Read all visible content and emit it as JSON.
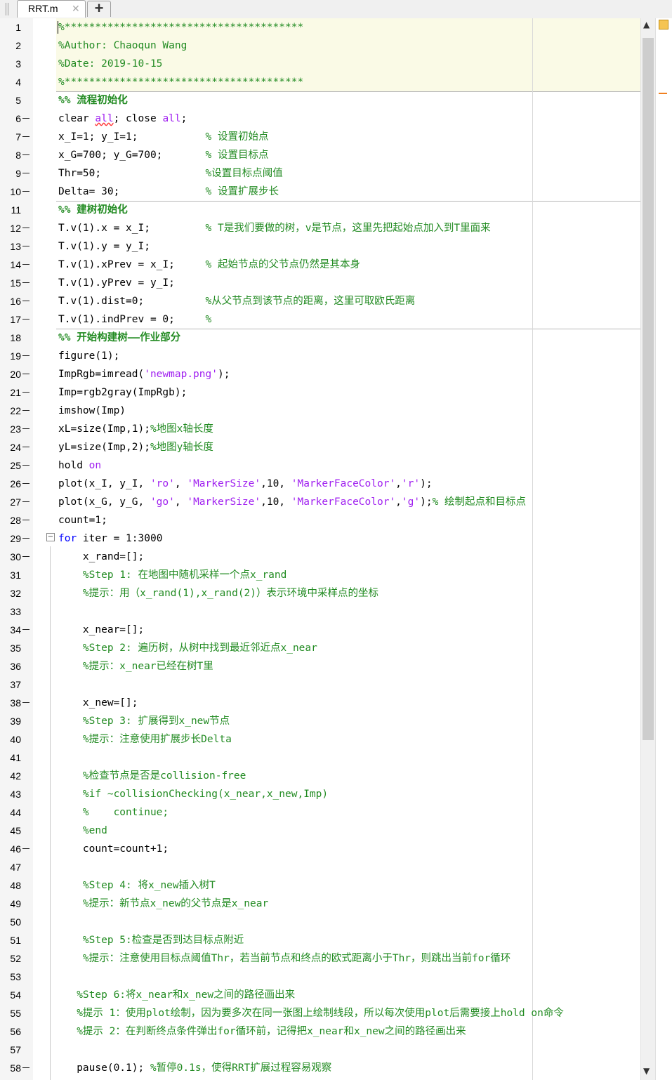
{
  "tabs": {
    "active": "RRT.m",
    "close_glyph": "✕",
    "add_glyph": "+"
  },
  "icons": {
    "fold": "fold-minus-icon",
    "status": "code-analyzer-status-icon",
    "scroll_up": "up-arrow-icon",
    "scroll_down": "down-arrow-icon"
  },
  "colors": {
    "keyword": "#0000ff",
    "string": "#a020f0",
    "comment": "#228b22",
    "cell_bg": "#fafae6",
    "status": "#f5c453"
  },
  "lines": [
    {
      "n": "1",
      "bp": false,
      "segs": [
        [
          "c",
          "%***************************************"
        ]
      ]
    },
    {
      "n": "2",
      "bp": false,
      "segs": [
        [
          "c",
          "%Author: Chaoqun Wang"
        ]
      ]
    },
    {
      "n": "3",
      "bp": false,
      "segs": [
        [
          "c",
          "%Date: 2019-10-15"
        ]
      ]
    },
    {
      "n": "4",
      "bp": false,
      "segs": [
        [
          "c",
          "%***************************************"
        ]
      ]
    },
    {
      "n": "5",
      "bp": false,
      "segs": [
        [
          "h",
          "%% 流程初始化"
        ]
      ]
    },
    {
      "n": "6",
      "bp": true,
      "segs": [
        [
          "t",
          "clear "
        ],
        [
          "su",
          "all"
        ],
        [
          "t",
          "; close "
        ],
        [
          "s",
          "all"
        ],
        [
          "t",
          ";"
        ]
      ]
    },
    {
      "n": "7",
      "bp": true,
      "segs": [
        [
          "t",
          "x_I=1; y_I=1;           "
        ],
        [
          "c",
          "% 设置初始点"
        ]
      ]
    },
    {
      "n": "8",
      "bp": true,
      "segs": [
        [
          "t",
          "x_G=700; y_G=700;       "
        ],
        [
          "c",
          "% 设置目标点"
        ]
      ]
    },
    {
      "n": "9",
      "bp": true,
      "segs": [
        [
          "t",
          "Thr=50;                 "
        ],
        [
          "c",
          "%设置目标点阈值"
        ]
      ]
    },
    {
      "n": "10",
      "bp": true,
      "segs": [
        [
          "t",
          "Delta= 30;              "
        ],
        [
          "c",
          "% 设置扩展步长"
        ]
      ]
    },
    {
      "n": "11",
      "bp": false,
      "segs": [
        [
          "h",
          "%% 建树初始化"
        ]
      ]
    },
    {
      "n": "12",
      "bp": true,
      "segs": [
        [
          "t",
          "T.v(1).x = x_I;         "
        ],
        [
          "c",
          "% T是我们要做的树，v是节点，这里先把起始点加入到T里面来"
        ]
      ]
    },
    {
      "n": "13",
      "bp": true,
      "segs": [
        [
          "t",
          "T.v(1).y = y_I;"
        ]
      ]
    },
    {
      "n": "14",
      "bp": true,
      "segs": [
        [
          "t",
          "T.v(1).xPrev = x_I;     "
        ],
        [
          "c",
          "% 起始节点的父节点仍然是其本身"
        ]
      ]
    },
    {
      "n": "15",
      "bp": true,
      "segs": [
        [
          "t",
          "T.v(1).yPrev = y_I;"
        ]
      ]
    },
    {
      "n": "16",
      "bp": true,
      "segs": [
        [
          "t",
          "T.v(1).dist=0;          "
        ],
        [
          "c",
          "%从父节点到该节点的距离，这里可取欧氏距离"
        ]
      ]
    },
    {
      "n": "17",
      "bp": true,
      "segs": [
        [
          "t",
          "T.v(1).indPrev = 0;     "
        ],
        [
          "c",
          "%"
        ]
      ]
    },
    {
      "n": "18",
      "bp": false,
      "segs": [
        [
          "h",
          "%% 开始构建树——作业部分"
        ]
      ]
    },
    {
      "n": "19",
      "bp": true,
      "segs": [
        [
          "t",
          "figure(1);"
        ]
      ]
    },
    {
      "n": "20",
      "bp": true,
      "segs": [
        [
          "t",
          "ImpRgb=imread("
        ],
        [
          "s",
          "'newmap.png'"
        ],
        [
          "t",
          ");"
        ]
      ]
    },
    {
      "n": "21",
      "bp": true,
      "segs": [
        [
          "t",
          "Imp=rgb2gray(ImpRgb);"
        ]
      ]
    },
    {
      "n": "22",
      "bp": true,
      "segs": [
        [
          "t",
          "imshow(Imp)"
        ]
      ]
    },
    {
      "n": "23",
      "bp": true,
      "segs": [
        [
          "t",
          "xL=size(Imp,1);"
        ],
        [
          "c",
          "%地图x轴长度"
        ]
      ]
    },
    {
      "n": "24",
      "bp": true,
      "segs": [
        [
          "t",
          "yL=size(Imp,2);"
        ],
        [
          "c",
          "%地图y轴长度"
        ]
      ]
    },
    {
      "n": "25",
      "bp": true,
      "segs": [
        [
          "t",
          "hold "
        ],
        [
          "s",
          "on"
        ]
      ]
    },
    {
      "n": "26",
      "bp": true,
      "segs": [
        [
          "t",
          "plot(x_I, y_I, "
        ],
        [
          "s",
          "'ro'"
        ],
        [
          "t",
          ", "
        ],
        [
          "s",
          "'MarkerSize'"
        ],
        [
          "t",
          ",10, "
        ],
        [
          "s",
          "'MarkerFaceColor'"
        ],
        [
          "t",
          ","
        ],
        [
          "s",
          "'r'"
        ],
        [
          "t",
          ");"
        ]
      ]
    },
    {
      "n": "27",
      "bp": true,
      "segs": [
        [
          "t",
          "plot(x_G, y_G, "
        ],
        [
          "s",
          "'go'"
        ],
        [
          "t",
          ", "
        ],
        [
          "s",
          "'MarkerSize'"
        ],
        [
          "t",
          ",10, "
        ],
        [
          "s",
          "'MarkerFaceColor'"
        ],
        [
          "t",
          ","
        ],
        [
          "s",
          "'g'"
        ],
        [
          "t",
          ");"
        ],
        [
          "c",
          "% 绘制起点和目标点"
        ]
      ]
    },
    {
      "n": "28",
      "bp": true,
      "segs": [
        [
          "t",
          "count=1;"
        ]
      ]
    },
    {
      "n": "29",
      "bp": true,
      "segs": [
        [
          "k",
          "for"
        ],
        [
          "t",
          " iter = 1:3000"
        ]
      ]
    },
    {
      "n": "30",
      "bp": true,
      "segs": [
        [
          "t",
          "    x_rand=[];"
        ]
      ]
    },
    {
      "n": "31",
      "bp": false,
      "segs": [
        [
          "t",
          "    "
        ],
        [
          "c",
          "%Step 1: 在地图中随机采样一个点x_rand"
        ]
      ]
    },
    {
      "n": "32",
      "bp": false,
      "segs": [
        [
          "t",
          "    "
        ],
        [
          "c",
          "%提示：用（x_rand(1),x_rand(2)）表示环境中采样点的坐标"
        ]
      ]
    },
    {
      "n": "33",
      "bp": false,
      "segs": []
    },
    {
      "n": "34",
      "bp": true,
      "segs": [
        [
          "t",
          "    x_near=[];"
        ]
      ]
    },
    {
      "n": "35",
      "bp": false,
      "segs": [
        [
          "t",
          "    "
        ],
        [
          "c",
          "%Step 2: 遍历树，从树中找到最近邻近点x_near"
        ]
      ]
    },
    {
      "n": "36",
      "bp": false,
      "segs": [
        [
          "t",
          "    "
        ],
        [
          "c",
          "%提示：x_near已经在树T里"
        ]
      ]
    },
    {
      "n": "37",
      "bp": false,
      "segs": []
    },
    {
      "n": "38",
      "bp": true,
      "segs": [
        [
          "t",
          "    x_new=[];"
        ]
      ]
    },
    {
      "n": "39",
      "bp": false,
      "segs": [
        [
          "t",
          "    "
        ],
        [
          "c",
          "%Step 3: 扩展得到x_new节点"
        ]
      ]
    },
    {
      "n": "40",
      "bp": false,
      "segs": [
        [
          "t",
          "    "
        ],
        [
          "c",
          "%提示：注意使用扩展步长Delta"
        ]
      ]
    },
    {
      "n": "41",
      "bp": false,
      "segs": []
    },
    {
      "n": "42",
      "bp": false,
      "segs": [
        [
          "t",
          "    "
        ],
        [
          "c",
          "%检查节点是否是collision-free"
        ]
      ]
    },
    {
      "n": "43",
      "bp": false,
      "segs": [
        [
          "t",
          "    "
        ],
        [
          "c",
          "%if ~collisionChecking(x_near,x_new,Imp)"
        ]
      ]
    },
    {
      "n": "44",
      "bp": false,
      "segs": [
        [
          "t",
          "    "
        ],
        [
          "c",
          "%    continue;"
        ]
      ]
    },
    {
      "n": "45",
      "bp": false,
      "segs": [
        [
          "t",
          "    "
        ],
        [
          "c",
          "%end"
        ]
      ]
    },
    {
      "n": "46",
      "bp": true,
      "segs": [
        [
          "t",
          "    count=count+1;"
        ]
      ]
    },
    {
      "n": "47",
      "bp": false,
      "segs": []
    },
    {
      "n": "48",
      "bp": false,
      "segs": [
        [
          "t",
          "    "
        ],
        [
          "c",
          "%Step 4: 将x_new插入树T"
        ]
      ]
    },
    {
      "n": "49",
      "bp": false,
      "segs": [
        [
          "t",
          "    "
        ],
        [
          "c",
          "%提示：新节点x_new的父节点是x_near"
        ]
      ]
    },
    {
      "n": "50",
      "bp": false,
      "segs": []
    },
    {
      "n": "51",
      "bp": false,
      "segs": [
        [
          "t",
          "    "
        ],
        [
          "c",
          "%Step 5:检查是否到达目标点附近"
        ]
      ]
    },
    {
      "n": "52",
      "bp": false,
      "segs": [
        [
          "t",
          "    "
        ],
        [
          "c",
          "%提示：注意使用目标点阈值Thr，若当前节点和终点的欧式距离小于Thr，则跳出当前for循环"
        ]
      ]
    },
    {
      "n": "53",
      "bp": false,
      "segs": []
    },
    {
      "n": "54",
      "bp": false,
      "segs": [
        [
          "t",
          "   "
        ],
        [
          "c",
          "%Step 6:将x_near和x_new之间的路径画出来"
        ]
      ]
    },
    {
      "n": "55",
      "bp": false,
      "segs": [
        [
          "t",
          "   "
        ],
        [
          "c",
          "%提示 1：使用plot绘制，因为要多次在同一张图上绘制线段，所以每次使用plot后需要接上hold on命令"
        ]
      ]
    },
    {
      "n": "56",
      "bp": false,
      "segs": [
        [
          "t",
          "   "
        ],
        [
          "c",
          "%提示 2：在判断终点条件弹出for循环前，记得把x_near和x_new之间的路径画出来"
        ]
      ]
    },
    {
      "n": "57",
      "bp": false,
      "segs": []
    },
    {
      "n": "58",
      "bp": true,
      "segs": [
        [
          "t",
          "   pause(0.1); "
        ],
        [
          "c",
          "%暂停0.1s，使得RRT扩展过程容易观察"
        ]
      ]
    }
  ]
}
